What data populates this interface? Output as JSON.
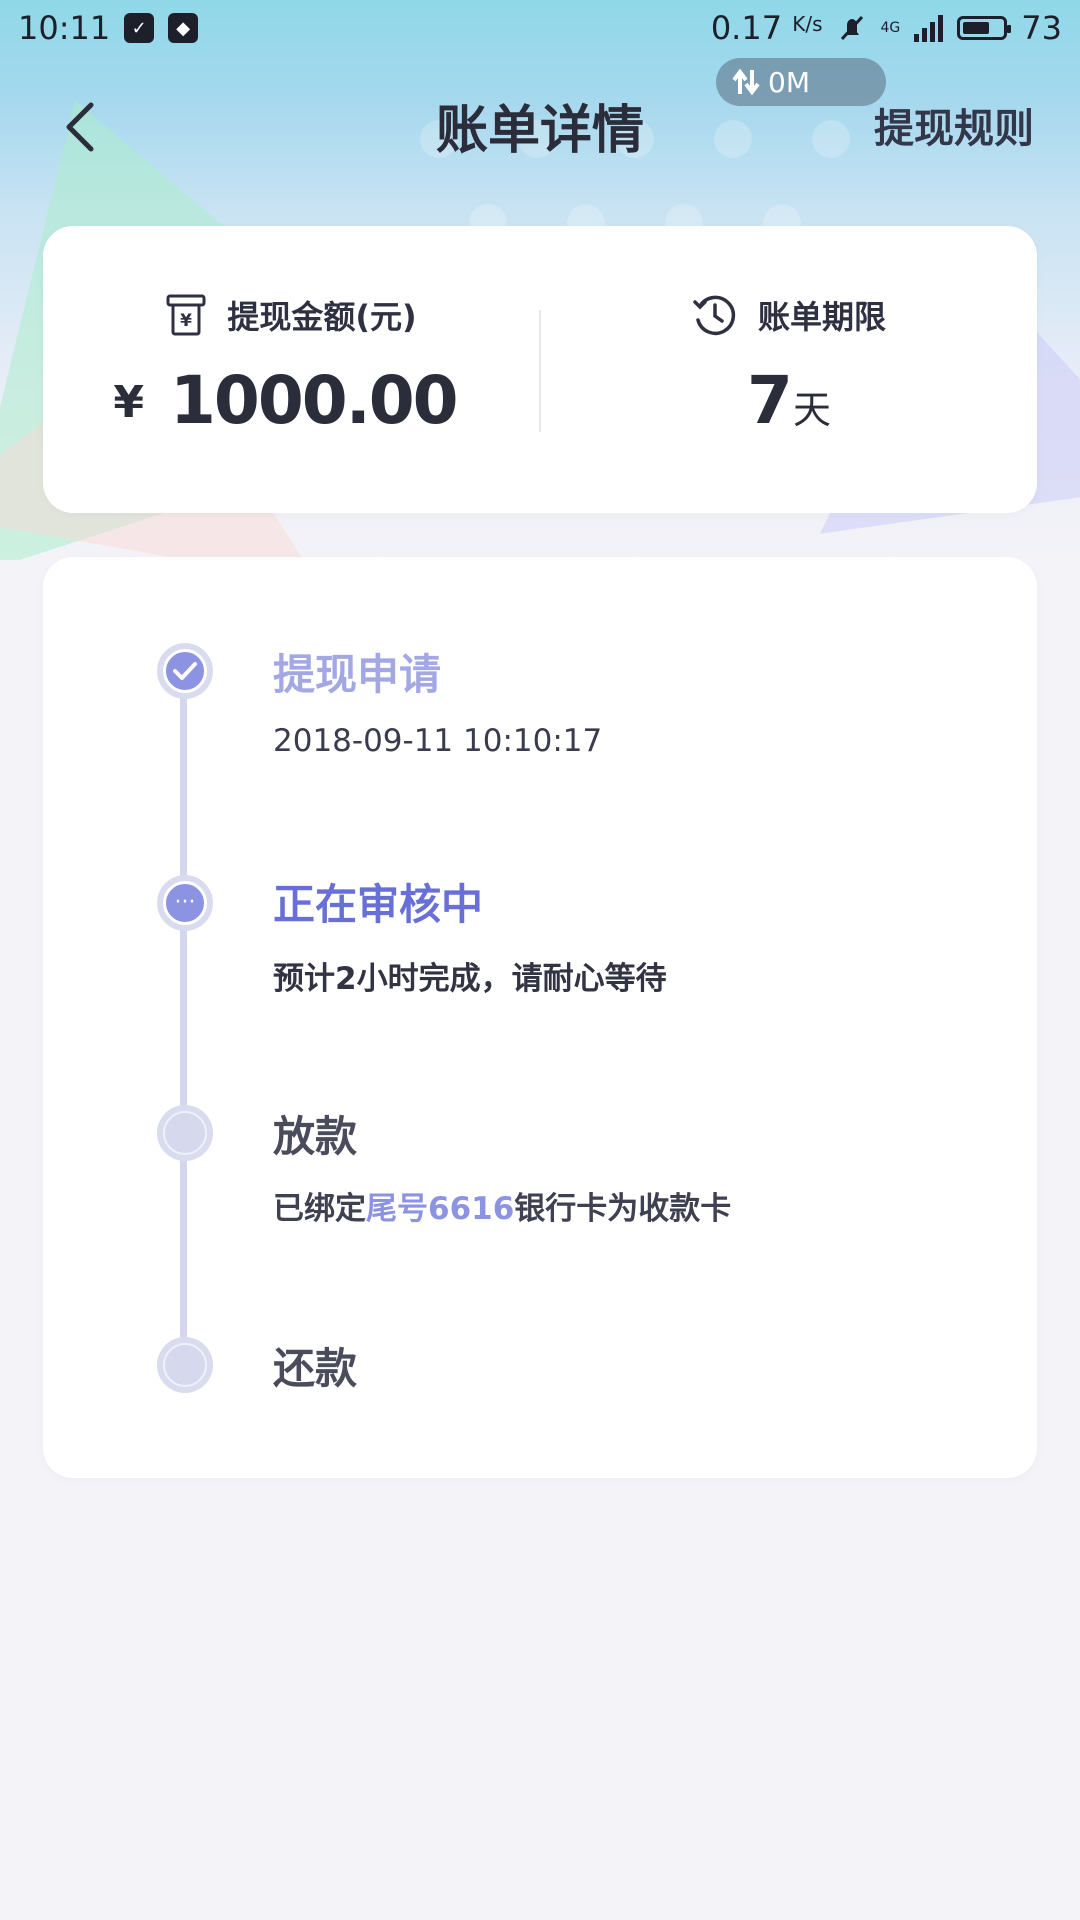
{
  "status_bar": {
    "time": "10:11",
    "net_speed": "0.17",
    "net_speed_unit": "K/s",
    "network_type": "4G",
    "battery": "73",
    "battery_level": 0.73
  },
  "overlay": {
    "traffic": "0M"
  },
  "nav": {
    "title": "账单详情",
    "rules_link": "提现规则"
  },
  "summary": {
    "amount_label": "提现金额(元)",
    "amount_currency": "¥",
    "amount_value": "1000.00",
    "term_label": "账单期限",
    "term_value": "7",
    "term_unit": "天"
  },
  "timeline": {
    "steps": [
      {
        "title": "提现申请",
        "subtitle": "2018-09-11 10:10:17",
        "state": "done"
      },
      {
        "title": "正在审核中",
        "subtitle": "预计2小时完成，请耐心等待",
        "state": "active"
      },
      {
        "title": "放款",
        "subtitle_prefix": "已绑定",
        "subtitle_highlight": "尾号6616",
        "subtitle_suffix": "银行卡为收款卡",
        "state": "pending"
      },
      {
        "title": "还款",
        "state": "pending"
      }
    ]
  },
  "colors": {
    "accent": "#8c93e2",
    "active_text": "#6870d8",
    "done_text": "#a3a8e4",
    "timeline_line": "#d4d7ec",
    "page_bg": "#f3f3f8"
  }
}
